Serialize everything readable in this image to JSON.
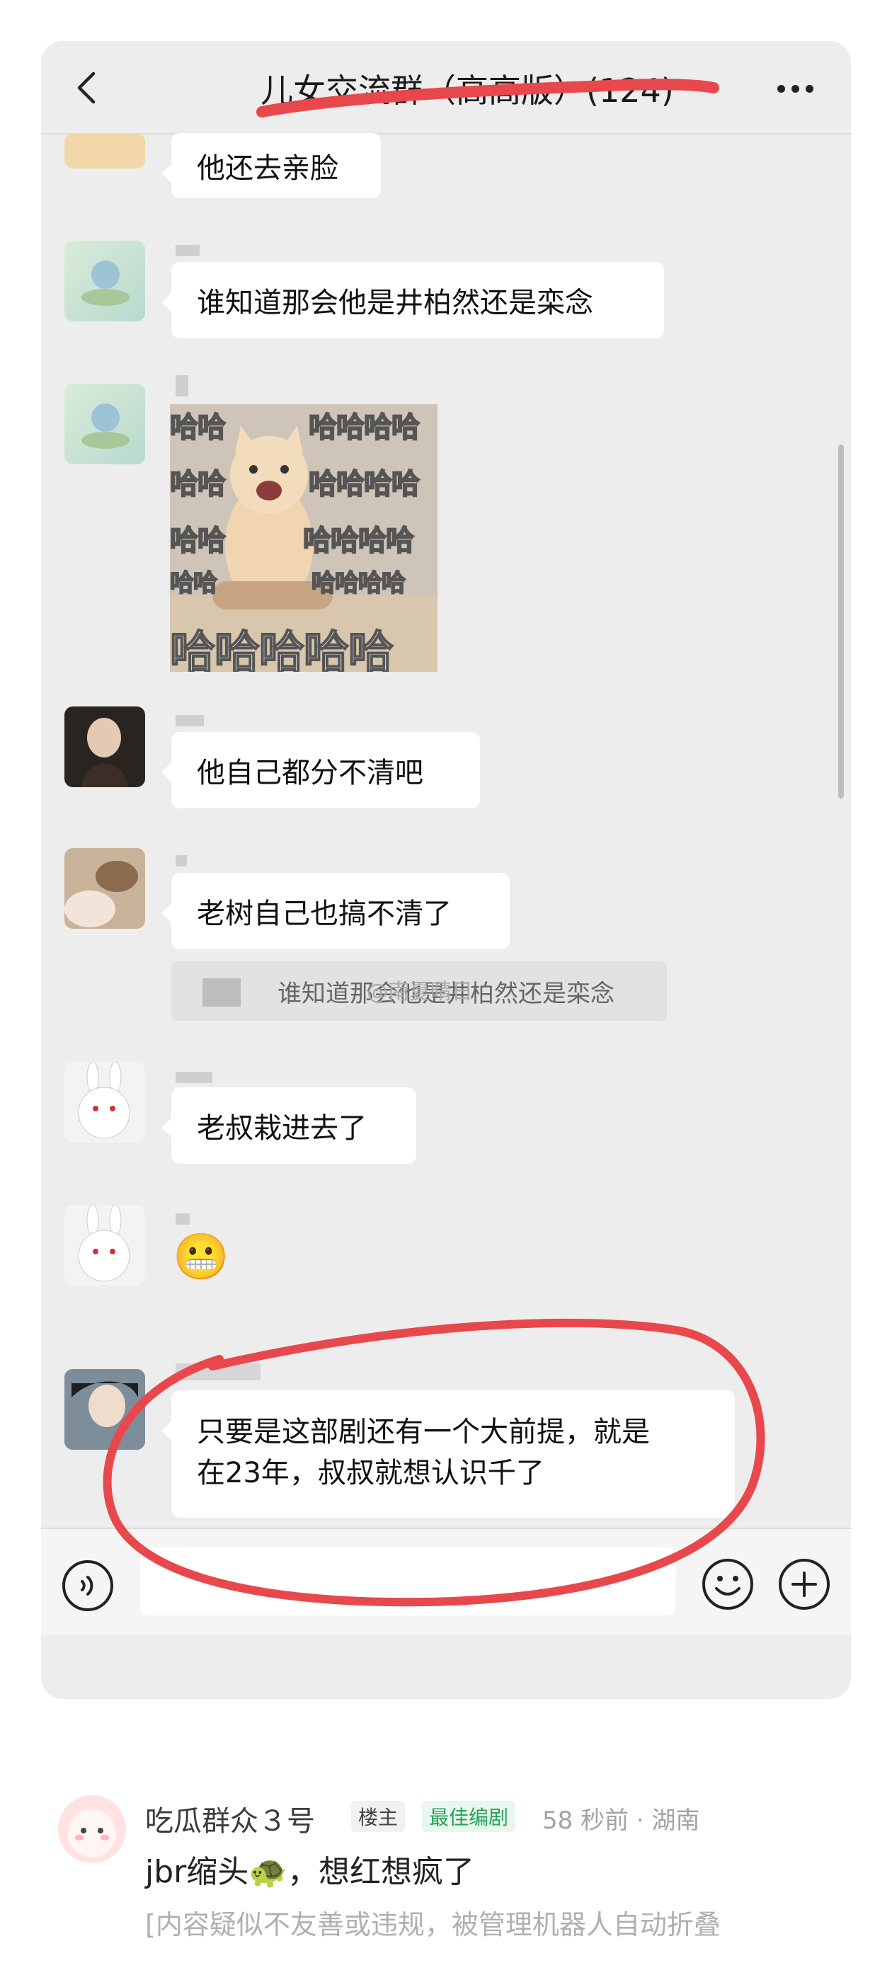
{
  "chat": {
    "title": "儿女交流群（高高版）(124)",
    "back_icon": "chevron-left-icon",
    "more_icon": "more-dots-icon"
  },
  "messages": [
    {
      "text": "他还去亲脸"
    },
    {
      "text": "谁知道那会他是井柏然还是栾念"
    },
    {
      "type": "image",
      "meme_texts": [
        "哈哈",
        "哈哈哈哈",
        "哈哈",
        "哈哈哈哈",
        "哈哈",
        "哈哈哈哈",
        "哈哈",
        "哈哈哈哈",
        "哈哈哈哈哈"
      ]
    },
    {
      "text": "他自己都分不清吧"
    },
    {
      "text": "老树自己也搞不清了",
      "quote": "谁知道那会他是井柏然还是栾念"
    },
    {
      "text": "老叔栽进去了"
    },
    {
      "text": "😬"
    },
    {
      "text_line1": "只要是这部剧还有一个大前提，就是",
      "text_line2": "在23年，叔叔就想认识千了"
    }
  ],
  "watermark": "@南夏晴日",
  "input_bar": {
    "voice_icon": "voice-icon",
    "emoji_icon": "smiley-icon",
    "plus_icon": "plus-icon"
  },
  "comment": {
    "name": "吃瓜群众３号",
    "badge_owner": "楼主",
    "badge_editor": "最佳编剧",
    "meta": "58 秒前 · 湖南",
    "text": "jbr缩头🐢，想红想疯了",
    "folded": "[内容疑似不友善或违规，被管理机器人自动折叠"
  },
  "colors": {
    "annotation_red": "#e8474c",
    "accent_green": "#22a45a"
  }
}
